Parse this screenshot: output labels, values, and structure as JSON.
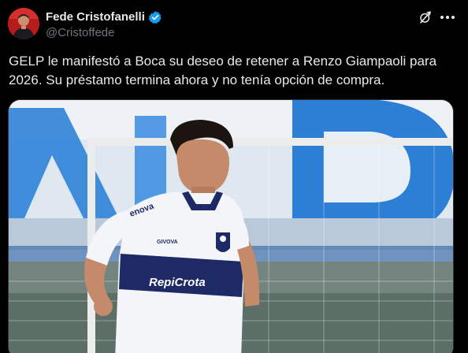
{
  "author": {
    "display_name": "Fede Cristofanelli",
    "handle": "@Cristoffede",
    "verified": true,
    "avatar_icon": "profile-photo"
  },
  "actions": {
    "grok_icon": "grok-icon",
    "more_icon": "more-horizontal-icon"
  },
  "tweet": {
    "text": "GELP le manifestó a Boca su deseo de retener a Renzo Giampaoli para\n2026. Su préstamo termina ahora y no tenía opción de compra."
  },
  "media": {
    "type": "photo",
    "jersey_sponsor": "RepiCrota",
    "sleeve_sponsor": "enova",
    "kit_brand": "GIVOVA",
    "colors": {
      "sky": "#e8eef5",
      "stand_blue": "#2b7fd6",
      "jersey_white": "#f4f5f8",
      "jersey_navy": "#1d2a66",
      "goal_post": "#e9e9e9"
    }
  },
  "theme": {
    "background": "#000000",
    "text_primary": "#e7e9ea",
    "text_secondary": "#71767b",
    "verified_blue": "#1d9bf0"
  }
}
